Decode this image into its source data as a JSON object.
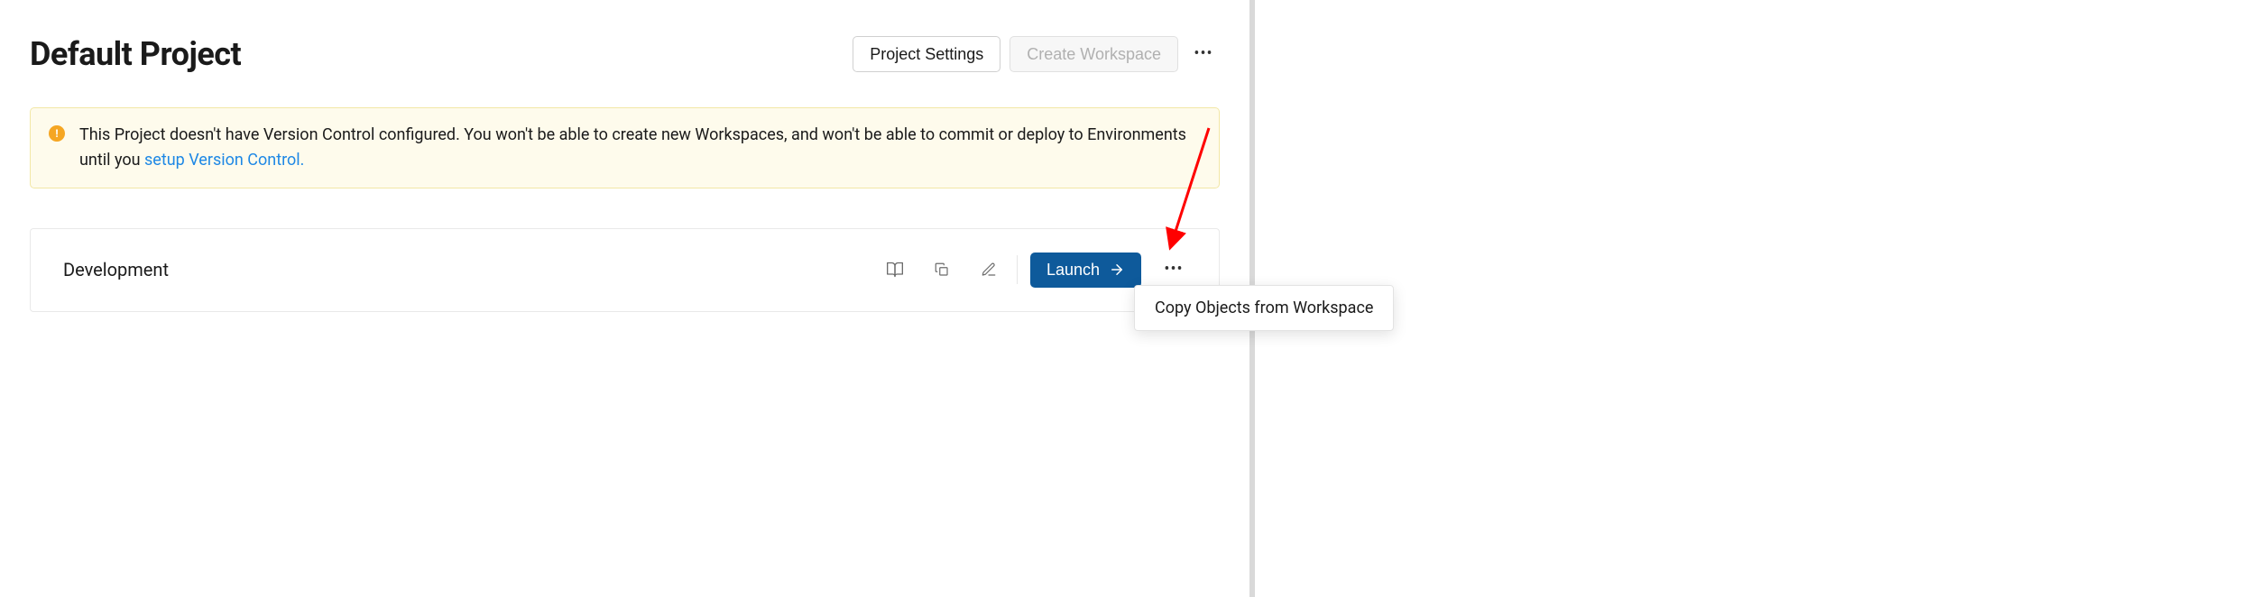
{
  "header": {
    "title": "Default Project",
    "project_settings_label": "Project Settings",
    "create_workspace_label": "Create Workspace"
  },
  "alert": {
    "text_before_link": "This Project doesn't have Version Control configured. You won't be able to create new Workspaces, and won't be able to commit or deploy to Environments until you ",
    "link_text": "setup Version Control."
  },
  "workspace": {
    "name": "Development",
    "launch_label": "Launch"
  },
  "context_menu": {
    "item_label": "Copy Objects from Workspace"
  }
}
